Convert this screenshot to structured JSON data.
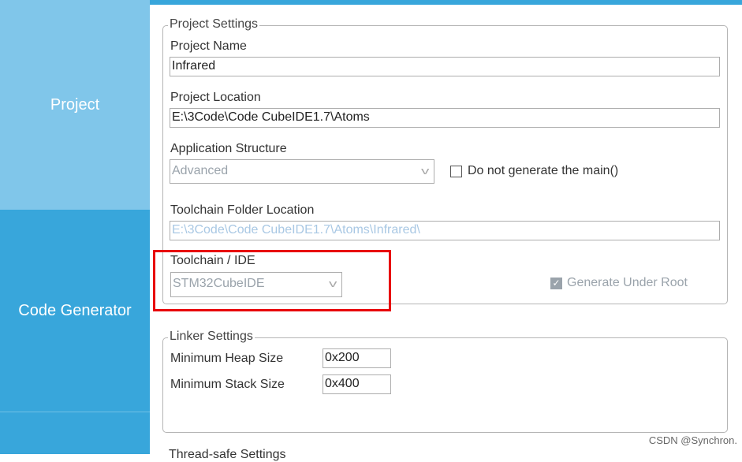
{
  "sidebar": {
    "items": [
      {
        "label": "Project"
      },
      {
        "label": "Code Generator"
      },
      {
        "label": ""
      }
    ]
  },
  "project_settings": {
    "title": "Project Settings",
    "name_label": "Project Name",
    "name_value": "Infrared",
    "location_label": "Project Location",
    "location_value": "E:\\3Code\\Code CubeIDE1.7\\Atoms",
    "structure_label": "Application Structure",
    "structure_value": "Advanced",
    "no_main_label": "Do not generate the main()",
    "no_main_checked": false,
    "toolchain_folder_label": "Toolchain Folder Location",
    "toolchain_folder_value": "E:\\3Code\\Code CubeIDE1.7\\Atoms\\Infrared\\",
    "toolchain_label": "Toolchain / IDE",
    "toolchain_value": "STM32CubeIDE",
    "gen_root_label": "Generate Under Root",
    "gen_root_checked": true
  },
  "linker_settings": {
    "title": "Linker Settings",
    "heap_label": "Minimum Heap Size",
    "heap_value": "0x200",
    "stack_label": "Minimum Stack Size",
    "stack_value": "0x400"
  },
  "thread_safe": {
    "title": "Thread-safe Settings"
  },
  "watermark": "CSDN @Synchron.",
  "colors": {
    "sidebar_light": "#80c6ea",
    "sidebar_active": "#38a6db",
    "highlight": "#e8000a"
  }
}
